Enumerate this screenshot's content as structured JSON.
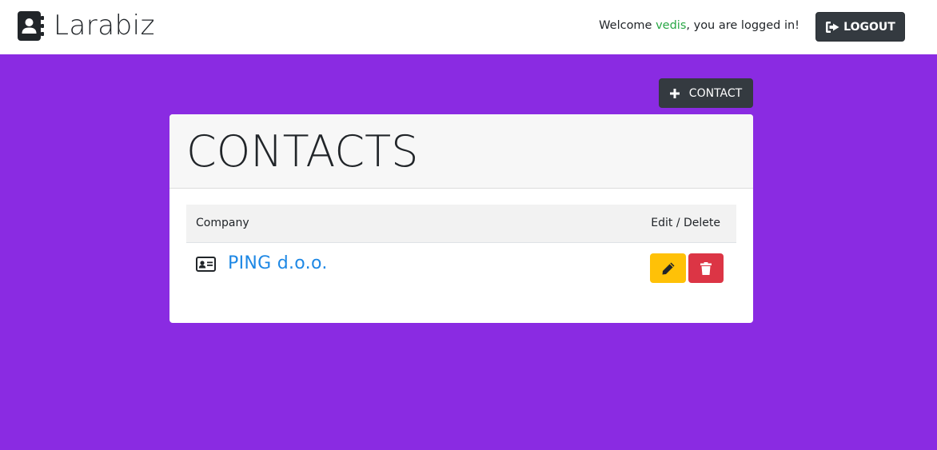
{
  "app": {
    "brand_name": "Larabiz"
  },
  "header": {
    "welcome_prefix": "Welcome ",
    "username": "vedis",
    "welcome_suffix": ", you are logged in!",
    "logout_label": "LOGOUT"
  },
  "toolbar": {
    "add_contact_label": "CONTACT"
  },
  "contacts": {
    "title": "CONTACTS",
    "columns": {
      "company": "Company",
      "actions": "Edit / Delete"
    },
    "rows": [
      {
        "company": "PING d.o.o."
      }
    ]
  },
  "colors": {
    "background": "#8a2be2",
    "dark_button": "#343a40",
    "edit_button": "#ffc107",
    "delete_button": "#dc3545",
    "link": "#1e88e5",
    "username": "#28a745"
  },
  "icons": {
    "brand": "address-book-icon",
    "logout": "sign-out-icon",
    "add": "plus-icon",
    "contact_card": "id-card-icon",
    "edit": "pencil-icon",
    "delete": "trash-icon"
  }
}
